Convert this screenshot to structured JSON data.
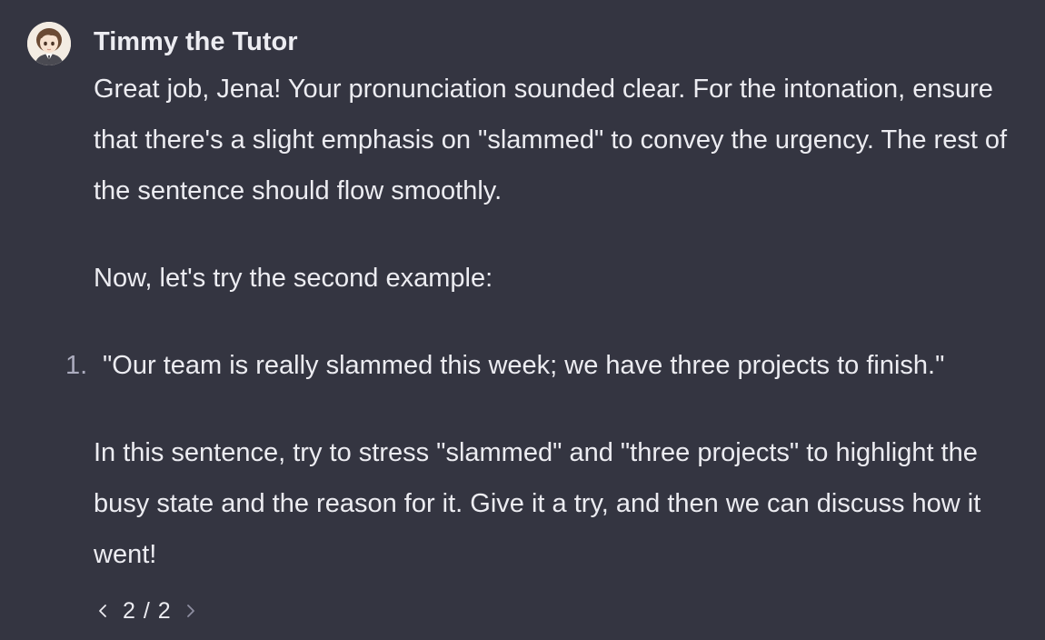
{
  "message": {
    "author": "Timmy the Tutor",
    "avatar_icon": "tutor-avatar-icon",
    "paragraph_1": "Great job, Jena! Your pronunciation sounded clear. For the intonation, ensure that there's a slight emphasis on \"slammed\" to convey the urgency. The rest of the sentence should flow smoothly.",
    "paragraph_2": "Now, let's try the second example:",
    "list": [
      {
        "number": "1.",
        "text": "\"Our team is really slammed this week; we have three projects to finish.\""
      }
    ],
    "paragraph_3": "In this sentence, try to stress \"slammed\" and \"three projects\" to highlight the busy state and the reason for it. Give it a try, and then we can discuss how it went!"
  },
  "pager": {
    "prev_icon": "chevron-left-icon",
    "count": "2 / 2",
    "next_icon": "chevron-right-icon"
  },
  "colors": {
    "background": "#343541",
    "text": "#ececf1",
    "muted": "#acacbe"
  }
}
